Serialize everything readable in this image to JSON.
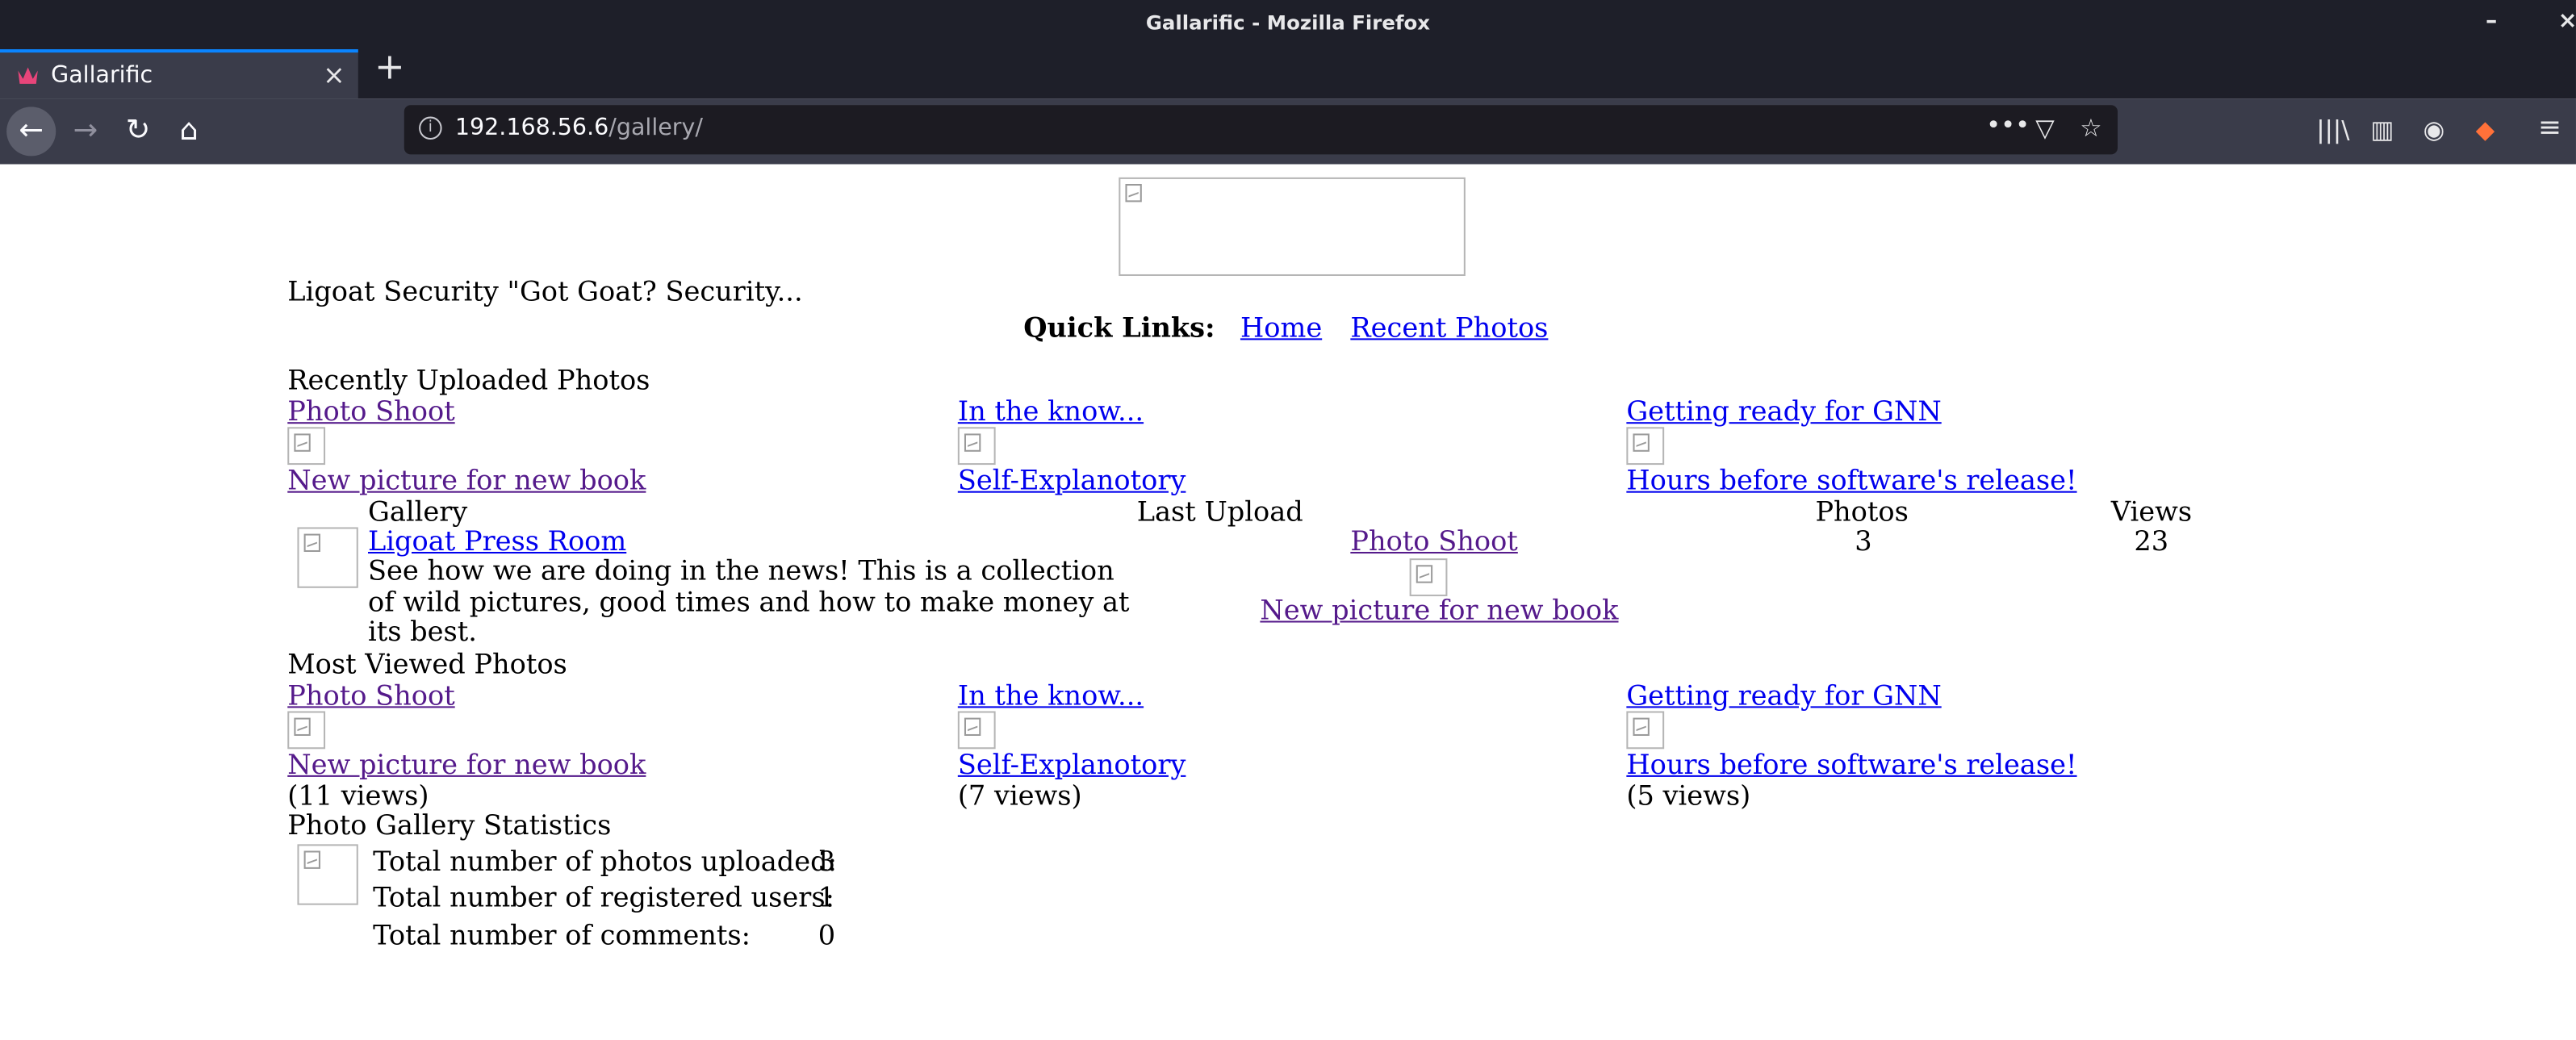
{
  "window": {
    "title": "Gallarific - Mozilla Firefox",
    "controls": [
      "–",
      "×"
    ]
  },
  "tab": {
    "label": "Gallarific",
    "close": "×",
    "new_tab": "+"
  },
  "nav": {
    "back": "←",
    "forward": "→",
    "reload": "↻",
    "home": "⌂",
    "url_host": "192.168.56.6",
    "url_path": "/gallery/",
    "info": "i",
    "more": "•••",
    "pocket": "▽",
    "bookmark": "☆",
    "library": "|||\\",
    "sidebar": "▥",
    "account": "◉",
    "extension": "◆",
    "menu": "≡"
  },
  "site": {
    "tagline": "Ligoat Security \"Got Goat? Security...",
    "quick_links_label": "Quick Links:",
    "quick_links": [
      "Home",
      "Recent Photos"
    ]
  },
  "recent": {
    "heading": "Recently Uploaded Photos",
    "items": [
      {
        "title": "Photo Shoot",
        "caption": "New picture for new book"
      },
      {
        "title": "In the know...",
        "caption": "Self-Explanotory"
      },
      {
        "title": "Getting ready for GNN",
        "caption": "Hours before software's release!"
      }
    ]
  },
  "galleries": {
    "headers": [
      "Gallery",
      "Last Upload",
      "Photos",
      "Views"
    ],
    "rows": [
      {
        "name": "Ligoat Press Room",
        "description": "See how we are doing in the news! This is a collection of wild pictures, good times and how to make money at its best.",
        "last_upload_title": "Photo Shoot",
        "last_upload_caption": "New picture for new book",
        "photos": "3",
        "views": "23"
      }
    ]
  },
  "most_viewed": {
    "heading": "Most Viewed Photos",
    "items": [
      {
        "title": "Photo Shoot",
        "caption": "New picture for new book",
        "views": "(11 views)"
      },
      {
        "title": "In the know...",
        "caption": "Self-Explanotory",
        "views": "(7 views)"
      },
      {
        "title": "Getting ready for GNN",
        "caption": "Hours before software's release!",
        "views": "(5 views)"
      }
    ]
  },
  "stats": {
    "heading": "Photo Gallery Statistics",
    "rows": [
      {
        "label": "Total number of photos uploaded:",
        "value": "3"
      },
      {
        "label": "Total number of registered users:",
        "value": "1"
      },
      {
        "label": "Total number of comments:",
        "value": "0"
      }
    ]
  },
  "colors": {
    "link": "#0000ee",
    "visited_link": "#551a8b",
    "chrome_dark": "#1e1f29",
    "toolbar": "#3a3c4a",
    "accent": "#0a84ff"
  }
}
